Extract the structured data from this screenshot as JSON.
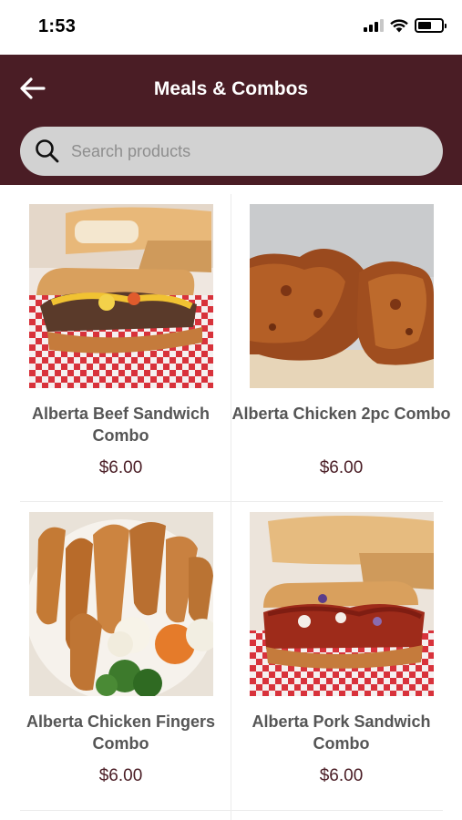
{
  "status_bar": {
    "time": "1:53"
  },
  "header": {
    "title": "Meals & Combos",
    "bg_color": "#4a1d25"
  },
  "search": {
    "placeholder": "Search products",
    "value": ""
  },
  "products": [
    {
      "name": "Alberta Beef Sandwich Combo",
      "price": "$6.00",
      "image": "beef-sandwich-image"
    },
    {
      "name": "Alberta Chicken 2pc Combo",
      "price": "$6.00",
      "image": "fried-chicken-image"
    },
    {
      "name": "Alberta Chicken Fingers Combo",
      "price": "$6.00",
      "image": "chicken-fingers-image"
    },
    {
      "name": "Alberta Pork Sandwich Combo",
      "price": "$6.00",
      "image": "pork-sandwich-image"
    }
  ]
}
